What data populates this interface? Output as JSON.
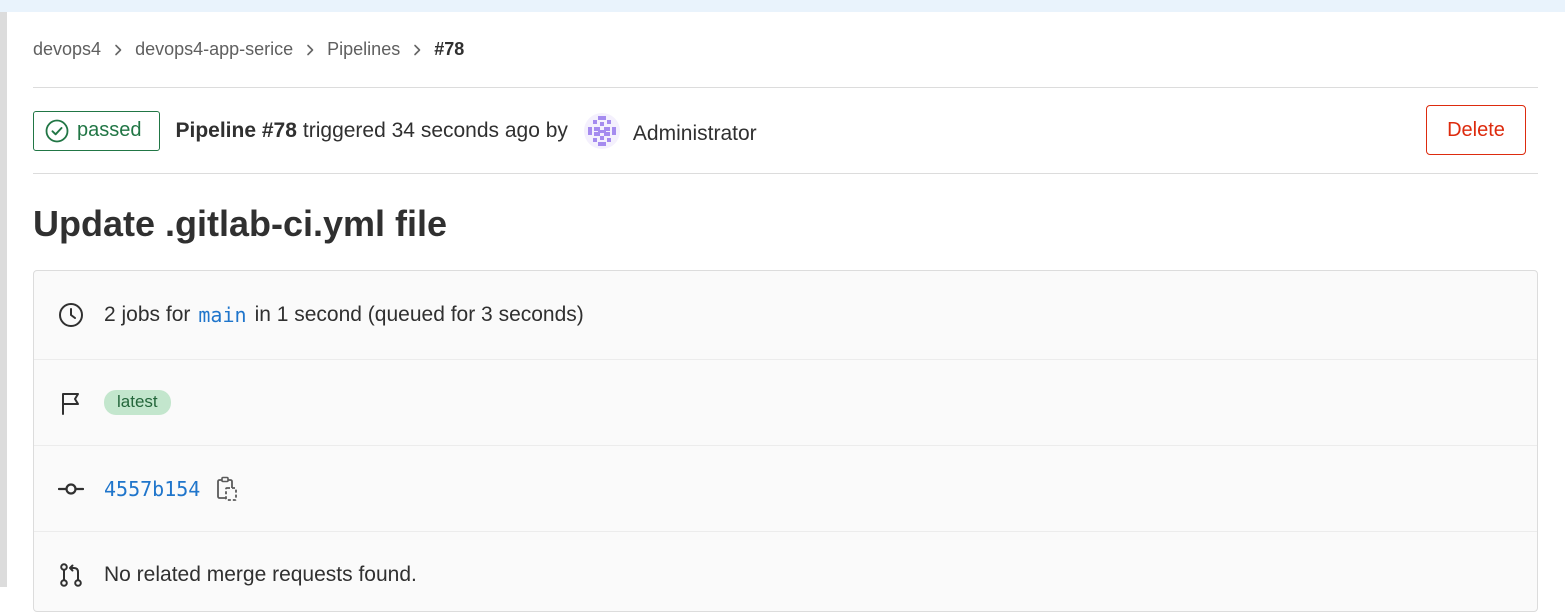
{
  "breadcrumb": [
    {
      "label": "devops4"
    },
    {
      "label": "devops4-app-serice"
    },
    {
      "label": "Pipelines"
    },
    {
      "label": "#78"
    }
  ],
  "header": {
    "status": "passed",
    "pipeline_id": "Pipeline #78",
    "triggered_text": "triggered 34 seconds ago by",
    "author": "Administrator",
    "delete_label": "Delete"
  },
  "commit_title": "Update .gitlab-ci.yml file",
  "details": {
    "jobs_prefix": "2 jobs for",
    "branch": "main",
    "jobs_suffix": "in 1 second (queued for 3 seconds)",
    "tag": "latest",
    "sha": "4557b154",
    "merge_requests": "No related merge requests found."
  },
  "icons": {
    "status": "check-circle-icon",
    "avatar": "identicon-avatar",
    "jobs": "clock-icon",
    "tag": "flag-icon",
    "commit": "commit-icon",
    "copy": "copy-to-clipboard-icon",
    "merge_requests": "merge-request-icon"
  },
  "colors": {
    "success": "#217645",
    "danger": "#dd2b0e",
    "link": "#1f75cb",
    "tag_bg": "#c3e6cd",
    "top_strip": "#e9f3fc",
    "avatar": "#a58bef"
  }
}
